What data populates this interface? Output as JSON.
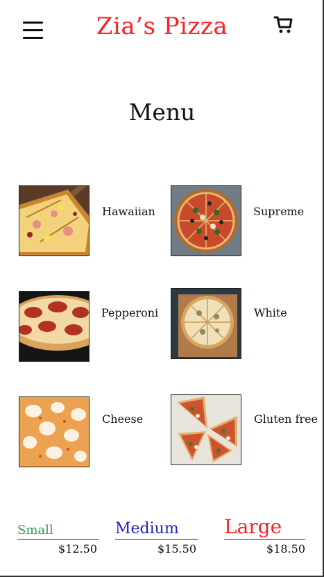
{
  "header": {
    "brand": "Zia’s Pizza",
    "menu_icon": "hamburger-menu-icon",
    "cart_icon": "shopping-cart-icon"
  },
  "page": {
    "title": "Menu"
  },
  "pizzas": [
    {
      "name": "Hawaiian"
    },
    {
      "name": "Supreme"
    },
    {
      "name": "Pepperoni"
    },
    {
      "name": "White"
    },
    {
      "name": "Cheese"
    },
    {
      "name": "Gluten free"
    }
  ],
  "sizes": [
    {
      "label": "Small",
      "price": "$12.50",
      "color": "#2e9e4a"
    },
    {
      "label": "Medium",
      "price": "$15.50",
      "color": "#2020c8"
    },
    {
      "label": "Large",
      "price": "$18.50",
      "color": "#ff1f1f"
    }
  ],
  "colors": {
    "brand": "#ff1f1f"
  }
}
